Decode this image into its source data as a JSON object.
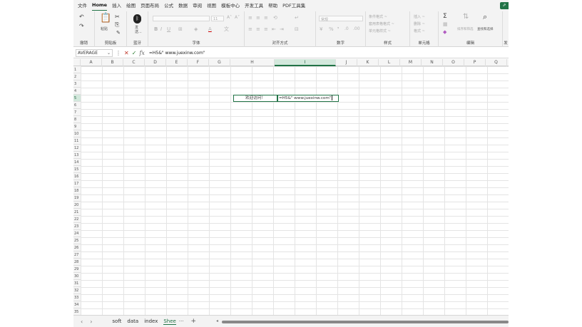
{
  "menu": {
    "items": [
      "文件",
      "Home",
      "插入",
      "绘图",
      "页面布局",
      "公式",
      "数据",
      "审阅",
      "视图",
      "模板中心",
      "开发工具",
      "帮助",
      "PDF工具集"
    ],
    "active": "Home",
    "share_glyph": "⇗"
  },
  "ribbon": {
    "groups": {
      "undo": "撤销",
      "clipboard": "剪贴板",
      "bluetooth": "蓝牙",
      "font": "字体",
      "alignment": "对齐方式",
      "number": "数字",
      "styles": "样式",
      "cells": "单元格",
      "editing": "编辑",
      "send": "发"
    },
    "paste_label": "粘贴",
    "send_label": "发\n送...",
    "font_size": "11",
    "number_format": "常规",
    "style_items": [
      "条件格式 ~",
      "套用表格格式 ~",
      "单元格样式 ~"
    ],
    "cell_items": [
      "插入 ~",
      "删除 ~",
      "格式 ~"
    ],
    "sort_filter": "排序和筛选",
    "find_select": "查找和选择",
    "sum_glyph": "Σ"
  },
  "formula_bar": {
    "name_box": "AVERAGE",
    "fx": "fx",
    "formula": "=H5&\" www.juexinw.com\""
  },
  "grid": {
    "columns": [
      "A",
      "B",
      "C",
      "D",
      "E",
      "F",
      "G",
      "H",
      "I",
      "J",
      "K",
      "L",
      "M",
      "N",
      "O",
      "P",
      "Q"
    ],
    "selected_column": "I",
    "selected_row": "5",
    "rows": [
      "1",
      "2",
      "3",
      "4",
      "5",
      "6",
      "7",
      "8",
      "9",
      "10",
      "11",
      "12",
      "13",
      "14",
      "15",
      "16",
      "17",
      "18",
      "19",
      "20",
      "21",
      "22",
      "23",
      "24",
      "25",
      "26",
      "27",
      "28",
      "29",
      "30",
      "31",
      "32",
      "33",
      "34",
      "35"
    ],
    "cells": {
      "H5": "欢迎访问！",
      "I5": "=H5&\" www.juexinw.com\""
    }
  },
  "sheets": {
    "tabs": [
      "soft",
      "data",
      "index",
      "Shee"
    ],
    "active": "Shee",
    "more": "···",
    "add": "+"
  }
}
